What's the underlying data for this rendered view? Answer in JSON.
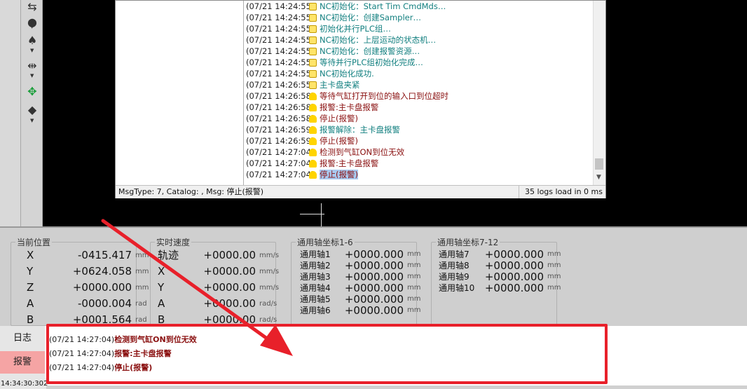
{
  "toolbar": {
    "tools": [
      "swap-arrows-icon",
      "drop-icon",
      "spade-icon",
      "mirror-icon",
      "dots-icon",
      "eraser-icon"
    ]
  },
  "log": {
    "rows": [
      {
        "time": "(07/21 14:24:55)",
        "type": "info",
        "msg": "NC初始化：Start Tim CmdMds…",
        "color": "teal"
      },
      {
        "time": "(07/21 14:24:55)",
        "type": "info",
        "msg": "NC初始化：创建Sampler…",
        "color": "teal"
      },
      {
        "time": "(07/21 14:24:55)",
        "type": "info",
        "msg": "初始化并行PLC组…",
        "color": "teal"
      },
      {
        "time": "(07/21 14:24:55)",
        "type": "info",
        "msg": "NC初始化：上层运动的状态机…",
        "color": "teal"
      },
      {
        "time": "(07/21 14:24:55)",
        "type": "info",
        "msg": "NC初始化：创建报警资源…",
        "color": "teal"
      },
      {
        "time": "(07/21 14:24:55)",
        "type": "info",
        "msg": "等待并行PLC组初始化完成…",
        "color": "teal"
      },
      {
        "time": "(07/21 14:24:55)",
        "type": "info",
        "msg": "NC初始化成功.",
        "color": "teal"
      },
      {
        "time": "(07/21 14:26:55)",
        "type": "info",
        "msg": "主卡盘夹紧",
        "color": "teal"
      },
      {
        "time": "(07/21 14:26:58)",
        "type": "warn",
        "msg": "等待气缸打开到位的输入口到位超时",
        "color": "red"
      },
      {
        "time": "(07/21 14:26:58)",
        "type": "warn",
        "msg": "报警:主卡盘报警",
        "color": "red"
      },
      {
        "time": "(07/21 14:26:58)",
        "type": "warn",
        "msg": "停止(报警)",
        "color": "red"
      },
      {
        "time": "(07/21 14:26:59)",
        "type": "warn",
        "msg": "报警解除：主卡盘报警",
        "color": "teal"
      },
      {
        "time": "(07/21 14:26:59)",
        "type": "warn",
        "msg": "停止(报警)",
        "color": "red"
      },
      {
        "time": "(07/21 14:27:04)",
        "type": "warn",
        "msg": "检测到气缸ON到位无效",
        "color": "red"
      },
      {
        "time": "(07/21 14:27:04)",
        "type": "warn",
        "msg": "报警:主卡盘报警",
        "color": "red"
      },
      {
        "time": "(07/21 14:27:04)",
        "type": "warn",
        "msg": "停止(报警)",
        "color": "red",
        "selected": true
      }
    ],
    "status_left": "MsgType: 7, Catalog: , Msg: 停止(报警)",
    "status_right": "35 logs load in 0 ms"
  },
  "position": {
    "title": "当前位置",
    "rows": [
      {
        "axis": "X",
        "value": "-0415.417",
        "unit": "mm"
      },
      {
        "axis": "Y",
        "value": "+0624.058",
        "unit": "mm"
      },
      {
        "axis": "Z",
        "value": "+0000.000",
        "unit": "mm"
      },
      {
        "axis": "A",
        "value": "-0000.004",
        "unit": "rad"
      },
      {
        "axis": "B",
        "value": "+0001.564",
        "unit": "rad"
      }
    ]
  },
  "speed": {
    "title": "实时速度",
    "rows": [
      {
        "axis": "轨迹",
        "value": "+0000.00",
        "unit": "mm/s"
      },
      {
        "axis": "X",
        "value": "+0000.00",
        "unit": "mm/s"
      },
      {
        "axis": "Y",
        "value": "+0000.00",
        "unit": "mm/s"
      },
      {
        "axis": "A",
        "value": "+0000.00",
        "unit": "rad/s"
      },
      {
        "axis": "B",
        "value": "+0000.00",
        "unit": "rad/s"
      }
    ]
  },
  "general1": {
    "title": "通用轴坐标1-6",
    "rows": [
      {
        "axis": "通用轴1",
        "value": "+0000.000",
        "unit": "mm"
      },
      {
        "axis": "通用轴2",
        "value": "+0000.000",
        "unit": "mm"
      },
      {
        "axis": "通用轴3",
        "value": "+0000.000",
        "unit": "mm"
      },
      {
        "axis": "通用轴4",
        "value": "+0000.000",
        "unit": "mm"
      },
      {
        "axis": "通用轴5",
        "value": "+0000.000",
        "unit": "mm"
      },
      {
        "axis": "通用轴6",
        "value": "+0000.000",
        "unit": "mm"
      }
    ]
  },
  "general2": {
    "title": "通用轴坐标7-12",
    "rows": [
      {
        "axis": "通用轴7",
        "value": "+0000.000",
        "unit": "mm"
      },
      {
        "axis": "通用轴8",
        "value": "+0000.000",
        "unit": "mm"
      },
      {
        "axis": "通用轴9",
        "value": "+0000.000",
        "unit": "mm"
      },
      {
        "axis": "通用轴10",
        "value": "+0000.000",
        "unit": "mm"
      }
    ]
  },
  "tabs": {
    "log": "日志",
    "alarm": "报警"
  },
  "messages": [
    {
      "time": "(07/21 14:27:04)",
      "text": "检测到气缸ON到位无效"
    },
    {
      "time": "(07/21 14:27:04)",
      "text": "报警:主卡盘报警"
    },
    {
      "time": "(07/21 14:27:04)",
      "text": "停止(报警)"
    }
  ],
  "clock": "14:34:30:302",
  "colors": {
    "teal_text": "#138080",
    "red_text": "#8a1010",
    "highlight_border": "#e8202a",
    "selected_tab": "#f5a4a4"
  }
}
